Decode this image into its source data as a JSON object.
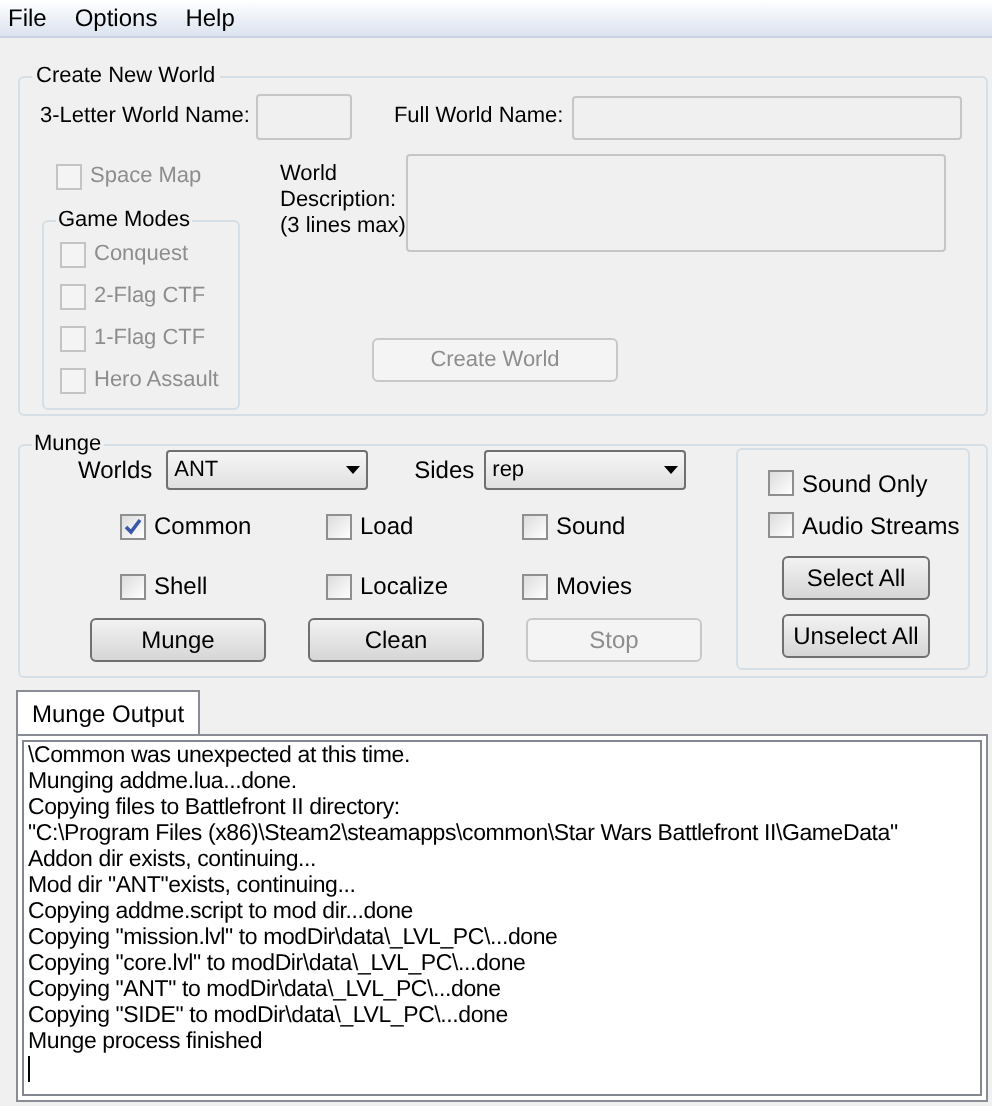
{
  "menu": [
    "File",
    "Options",
    "Help"
  ],
  "create_world": {
    "title": "Create New World",
    "short_name": {
      "label": "3-Letter World Name:",
      "disabled": true
    },
    "full_name": {
      "label": "Full World Name:",
      "disabled": true
    },
    "space_map": {
      "label": "Space Map",
      "checked": false,
      "disabled": true
    },
    "game_modes": {
      "title": "Game Modes",
      "options": [
        {
          "label": "Conquest",
          "checked": false,
          "disabled": true
        },
        {
          "label": "2-Flag CTF",
          "checked": false,
          "disabled": true
        },
        {
          "label": "1-Flag CTF",
          "checked": false,
          "disabled": true
        },
        {
          "label": "Hero Assault",
          "checked": false,
          "disabled": true
        }
      ]
    },
    "description": {
      "label_lines": [
        "World",
        "Description:",
        "(3 lines max)"
      ],
      "disabled": true
    },
    "button": {
      "label": "Create World",
      "disabled": true
    }
  },
  "munge": {
    "title": "Munge",
    "worlds": {
      "label": "Worlds",
      "value": "ANT"
    },
    "sides": {
      "label": "Sides",
      "value": "rep"
    },
    "options": [
      {
        "label": "Common",
        "checked": true
      },
      {
        "label": "Load",
        "checked": false
      },
      {
        "label": "Sound",
        "checked": false
      },
      {
        "label": "Shell",
        "checked": false
      },
      {
        "label": "Localize",
        "checked": false
      },
      {
        "label": "Movies",
        "checked": false
      }
    ],
    "buttons": [
      {
        "label": "Munge",
        "disabled": false
      },
      {
        "label": "Clean",
        "disabled": false
      },
      {
        "label": "Stop",
        "disabled": true
      }
    ],
    "side_options": [
      {
        "label": "Sound Only",
        "checked": false
      },
      {
        "label": "Audio Streams",
        "checked": false
      }
    ],
    "side_buttons": [
      {
        "label": "Select All",
        "disabled": false
      },
      {
        "label": "Unselect All",
        "disabled": false
      }
    ]
  },
  "output": {
    "tabs": [
      {
        "label": "Munge Output",
        "selected": true
      }
    ],
    "lines": [
      "\\Common was unexpected at this time.",
      "Munging addme.lua...done.",
      "Copying files to Battlefront II directory:",
      "\"C:\\Program Files (x86)\\Steam2\\steamapps\\common\\Star Wars Battlefront II\\GameData\"",
      "Addon dir exists, continuing...",
      "Mod dir \"ANT\"exists, continuing...",
      "Copying addme.script to mod dir...done",
      "Copying \"mission.lvl\" to modDir\\data\\_LVL_PC\\...done",
      "Copying \"core.lvl\" to modDir\\data\\_LVL_PC\\...done",
      "Copying \"ANT\" to modDir\\data\\_LVL_PC\\...done",
      "Copying \"SIDE\" to modDir\\data\\_LVL_PC\\...done",
      "Munge process finished"
    ]
  }
}
